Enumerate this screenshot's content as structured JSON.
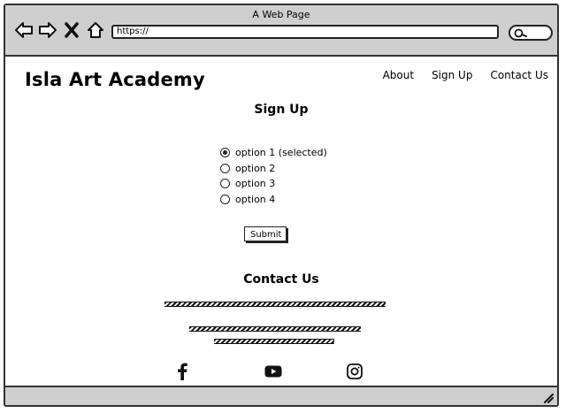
{
  "window": {
    "title": "A Web Page"
  },
  "browser": {
    "url": "https://"
  },
  "site": {
    "brand": "Isla Art Academy",
    "nav": [
      {
        "label": "About"
      },
      {
        "label": "Sign Up"
      },
      {
        "label": "Contact Us"
      }
    ]
  },
  "signup": {
    "heading": "Sign Up",
    "options": [
      {
        "label": "option 1 (selected)",
        "selected": true
      },
      {
        "label": "option 2",
        "selected": false
      },
      {
        "label": "option 3",
        "selected": false
      },
      {
        "label": "option 4",
        "selected": false
      }
    ],
    "submit_label": "Submit"
  },
  "contact": {
    "heading": "Contact Us"
  },
  "social": {
    "icons": [
      "facebook-icon",
      "youtube-icon",
      "instagram-icon"
    ]
  }
}
